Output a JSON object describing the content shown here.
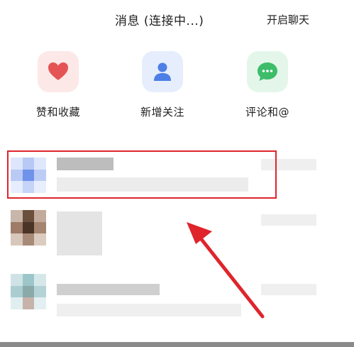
{
  "header": {
    "title": "消息 (连接中...)",
    "action_label": "开启聊天"
  },
  "shortcuts": [
    {
      "label": "赞和收藏",
      "icon": "heart-icon",
      "color": "#e55454"
    },
    {
      "label": "新增关注",
      "icon": "person-icon",
      "color": "#4d7fe6"
    },
    {
      "label": "评论和@",
      "icon": "chat-bubble-icon",
      "color": "#3dbd6a"
    }
  ],
  "colors": {
    "highlight": "#e0242c",
    "arrow": "#e0242c"
  }
}
